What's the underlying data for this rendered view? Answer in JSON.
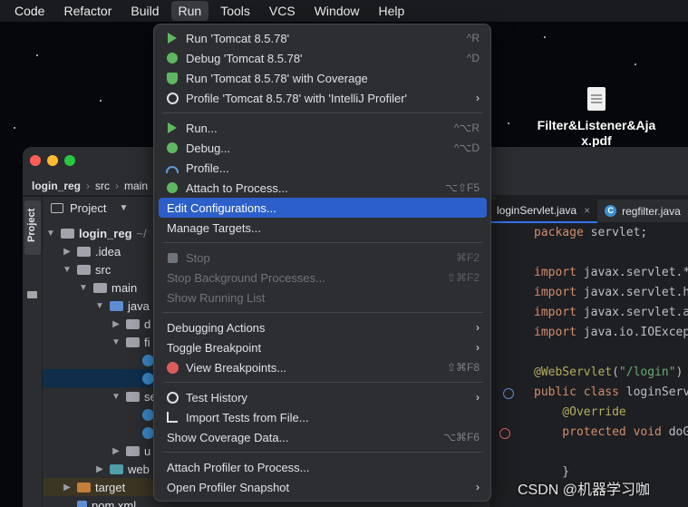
{
  "menubar": {
    "items": [
      "Code",
      "Refactor",
      "Build",
      "Run",
      "Tools",
      "VCS",
      "Window",
      "Help"
    ],
    "active": "Run"
  },
  "desktop": {
    "file_label_line1": "Filter&Listener&Aja",
    "file_label_line2": "x.pdf"
  },
  "ide": {
    "breadcrumbs": [
      "login_reg",
      "src",
      "main"
    ],
    "tool_tab": "Project",
    "project_header": "Project",
    "tree": [
      {
        "label": "login_reg",
        "extra": "~/"
      },
      {
        "label": ".idea"
      },
      {
        "label": "src"
      },
      {
        "label": "main"
      },
      {
        "label": "java"
      },
      {
        "label": "d"
      },
      {
        "label": "fi"
      },
      {
        "label": "se"
      },
      {
        "label": "u"
      },
      {
        "label": "web"
      },
      {
        "label": "target"
      },
      {
        "label": "pom.xml"
      }
    ],
    "tabs": [
      {
        "label": "loginServlet.java"
      },
      {
        "label": "regfilter.java"
      }
    ],
    "code_lines": {
      "l1_kw": "package",
      "l1_rest": " servlet;",
      "l2_kw": "import",
      "l2_rest": " javax.servlet.*",
      "l3_kw": "import",
      "l3_rest": " javax.servlet.h",
      "l4_kw": "import",
      "l4_rest": " javax.servlet.a",
      "l5_kw": "import",
      "l5_rest": " java.io.IOExcep",
      "l6_ann": "@WebServlet",
      "l6_a": "(",
      "l6_str": "\"/login\"",
      "l6_b": ")",
      "l7_kw": "public class",
      "l7_rest": " loginServ",
      "l8_ann": "    @Override",
      "l9_kw": "    protected void",
      "l9_rest": " doG",
      "l10": "    }"
    }
  },
  "run_menu": {
    "run_tomcat": {
      "label": "Run 'Tomcat 8.5.78'",
      "shortcut": "^R"
    },
    "debug_tomcat": {
      "label": "Debug 'Tomcat 8.5.78'",
      "shortcut": "^D"
    },
    "run_coverage": {
      "label": "Run 'Tomcat 8.5.78' with Coverage"
    },
    "profile_tomcat": {
      "label": "Profile 'Tomcat 8.5.78' with 'IntelliJ Profiler'",
      "submenu": "›"
    },
    "run": {
      "label": "Run...",
      "shortcut": "^⌥R"
    },
    "debug": {
      "label": "Debug...",
      "shortcut": "^⌥D"
    },
    "profile": {
      "label": "Profile..."
    },
    "attach": {
      "label": "Attach to Process...",
      "shortcut": "⌥⇧F5"
    },
    "edit_configs": {
      "label": "Edit Configurations..."
    },
    "manage_targets": {
      "label": "Manage Targets..."
    },
    "stop": {
      "label": "Stop",
      "shortcut": "⌘F2"
    },
    "stop_bg": {
      "label": "Stop Background Processes...",
      "shortcut": "⇧⌘F2"
    },
    "show_running": {
      "label": "Show Running List"
    },
    "debugging_actions": {
      "label": "Debugging Actions",
      "submenu": "›"
    },
    "toggle_bp": {
      "label": "Toggle Breakpoint",
      "submenu": "›"
    },
    "view_bp": {
      "label": "View Breakpoints...",
      "shortcut": "⇧⌘F8"
    },
    "test_history": {
      "label": "Test History",
      "submenu": "›"
    },
    "import_tests": {
      "label": "Import Tests from File..."
    },
    "show_coverage": {
      "label": "Show Coverage Data...",
      "shortcut": "⌥⌘F6"
    },
    "attach_profiler": {
      "label": "Attach Profiler to Process..."
    },
    "open_snapshot": {
      "label": "Open Profiler Snapshot",
      "submenu": "›"
    }
  },
  "watermark": "CSDN @机器学习咖",
  "colors": {
    "highlight": "#2c5fc9",
    "run_green": "#5fb760",
    "menu_bg": "#2d2e32"
  }
}
